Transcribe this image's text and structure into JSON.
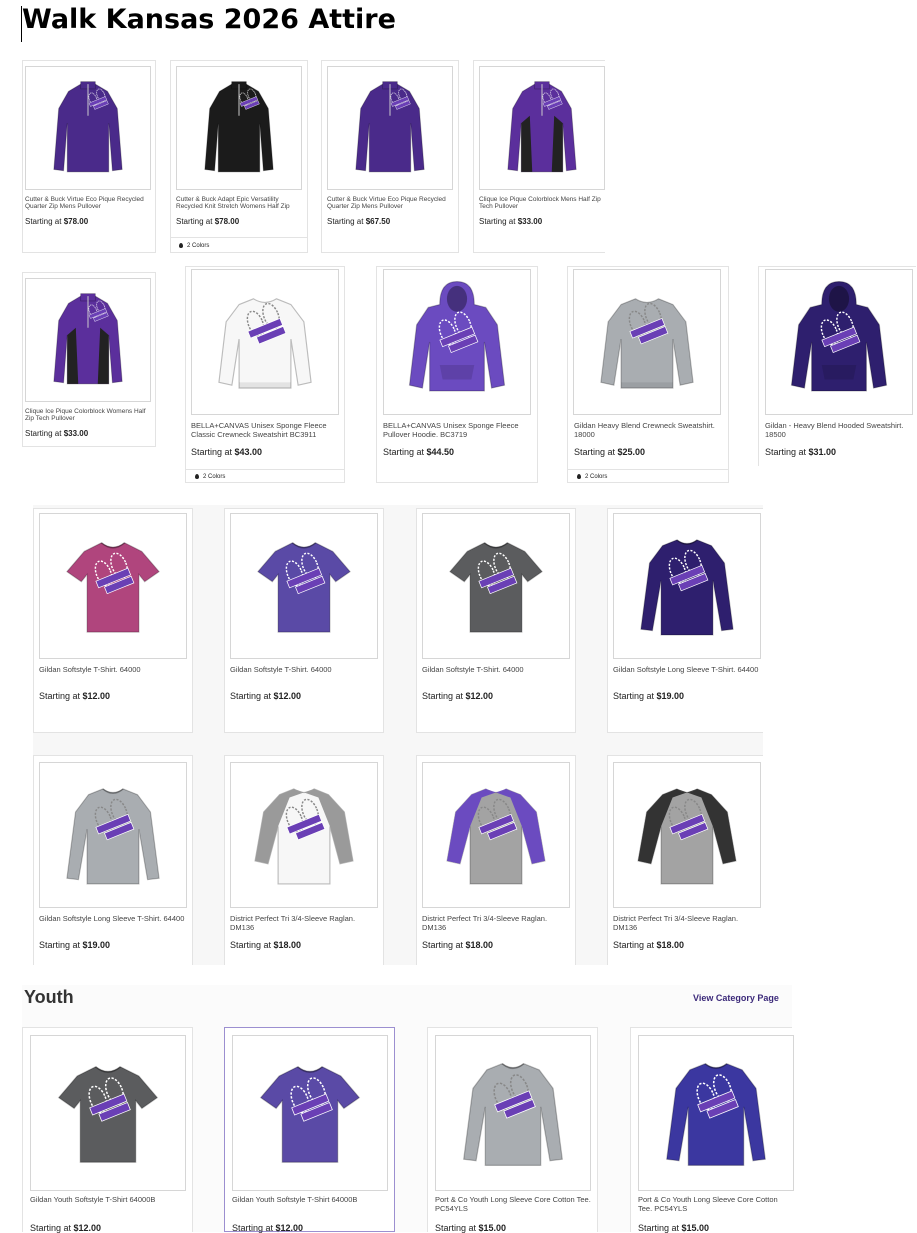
{
  "doc": {
    "title": "Walk Kansas 2026 Attire"
  },
  "colors": {
    "purple": "#4a2a8a",
    "violet": "#6b4bc0",
    "navy": "#2e1f6e",
    "black": "#1b1b1b",
    "white": "#f7f7f7",
    "heather_grey": "#a9adb1",
    "charcoal": "#5b5c5e",
    "berry": "#b0457d",
    "royal": "#3b37a0",
    "link": "#3c2a7a"
  },
  "products": [
    {
      "name": "Cutter & Buck Virtue Eco Pique Recycled Quarter Zip Mens Pullover",
      "price_prefix": "Starting at ",
      "price": "$78.00",
      "garment": "quarterzip",
      "color": "#4a2a8a"
    },
    {
      "name": "Cutter & Buck Adapt Epic Versatility Recycled Knit Stretch Womens Half Zip",
      "price_prefix": "Starting at ",
      "price": "$78.00",
      "colors_count": "2 Colors",
      "garment": "quarterzip",
      "color": "#1b1b1b"
    },
    {
      "name": "Cutter & Buck Virtue Eco Pique Recycled Quarter Zip Mens Pullover",
      "price_prefix": "Starting at ",
      "price": "$67.50",
      "garment": "quarterzip",
      "color": "#4a2a8a"
    },
    {
      "name": "Clique Ice Pique Colorblock Mens Half Zip Tech Pullover",
      "price_prefix": "Starting at ",
      "price": "$33.00",
      "garment": "quarterzip",
      "color": "#5b2f9c",
      "accent": "#222"
    },
    {
      "name": "Clique Ice Pique Colorblock Womens Half Zip Tech Pullover",
      "price_prefix": "Starting at ",
      "price": "$33.00",
      "garment": "quarterzip",
      "color": "#5b2f9c",
      "accent": "#222"
    },
    {
      "name": "BELLA+CANVAS Unisex Sponge Fleece Classic Crewneck Sweatshirt BC3911",
      "price_prefix": "Starting at ",
      "price": "$43.00",
      "colors_count": "2 Colors",
      "garment": "crewneck",
      "color": "#f7f7f7"
    },
    {
      "name": "BELLA+CANVAS Unisex Sponge Fleece Pullover Hoodie. BC3719",
      "price_prefix": "Starting at ",
      "price": "$44.50",
      "garment": "hoodie",
      "color": "#6b4bc0"
    },
    {
      "name": "Gildan Heavy Blend Crewneck Sweatshirt. 18000",
      "price_prefix": "Starting at ",
      "price": "$25.00",
      "colors_count": "2 Colors",
      "garment": "crewneck",
      "color": "#a9adb1"
    },
    {
      "name": "Gildan - Heavy Blend Hooded Sweatshirt. 18500",
      "price_prefix": "Starting at ",
      "price": "$31.00",
      "garment": "hoodie",
      "color": "#2e1f6e"
    },
    {
      "name": "Gildan Softstyle T-Shirt. 64000",
      "price_prefix": "Starting at ",
      "price": "$12.00",
      "garment": "tee",
      "color": "#b0457d"
    },
    {
      "name": "Gildan Softstyle T-Shirt. 64000",
      "price_prefix": "Starting at ",
      "price": "$12.00",
      "garment": "tee",
      "color": "#5a4aa6"
    },
    {
      "name": "Gildan Softstyle T-Shirt. 64000",
      "price_prefix": "Starting at ",
      "price": "$12.00",
      "garment": "tee",
      "color": "#5b5c5e"
    },
    {
      "name": "Gildan Softstyle Long Sleeve T-Shirt. 64400",
      "price_prefix": "Starting at ",
      "price": "$19.00",
      "garment": "longsleeve",
      "color": "#2e1f6e"
    },
    {
      "name": "Gildan Softstyle Long Sleeve T-Shirt. 64400",
      "price_prefix": "Starting at ",
      "price": "$19.00",
      "garment": "longsleeve",
      "color": "#a9adb1"
    },
    {
      "name": "District Perfect Tri 3/4-Sleeve Raglan. DM136",
      "price_prefix": "Starting at ",
      "price": "$18.00",
      "garment": "raglan",
      "color": "#f7f7f7",
      "accent": "#9a9a9a"
    },
    {
      "name": "District Perfect Tri 3/4-Sleeve Raglan. DM136",
      "price_prefix": "Starting at ",
      "price": "$18.00",
      "garment": "raglan",
      "color": "#a3a3a3",
      "accent": "#6b4bc0"
    },
    {
      "name": "District Perfect Tri 3/4-Sleeve Raglan. DM136",
      "price_prefix": "Starting at ",
      "price": "$18.00",
      "garment": "raglan",
      "color": "#a3a3a3",
      "accent": "#333"
    }
  ],
  "youth": {
    "heading": "Youth",
    "view_link": "View Category Page",
    "products": [
      {
        "name": "Gildan Youth Softstyle T-Shirt 64000B",
        "price_prefix": "Starting at ",
        "price": "$12.00",
        "garment": "tee",
        "color": "#5b5c5e"
      },
      {
        "name": "Gildan Youth Softstyle T-Shirt 64000B",
        "price_prefix": "Starting at ",
        "price": "$12.00",
        "garment": "tee",
        "color": "#5a4aa6"
      },
      {
        "name": "Port & Co Youth Long Sleeve Core Cotton Tee. PC54YLS",
        "price_prefix": "Starting at ",
        "price": "$15.00",
        "garment": "longsleeve",
        "color": "#a9adb1"
      },
      {
        "name": "Port & Co Youth Long Sleeve Core Cotton Tee. PC54YLS",
        "price_prefix": "Starting at ",
        "price": "$15.00",
        "garment": "longsleeve",
        "color": "#3b37a0"
      }
    ]
  }
}
